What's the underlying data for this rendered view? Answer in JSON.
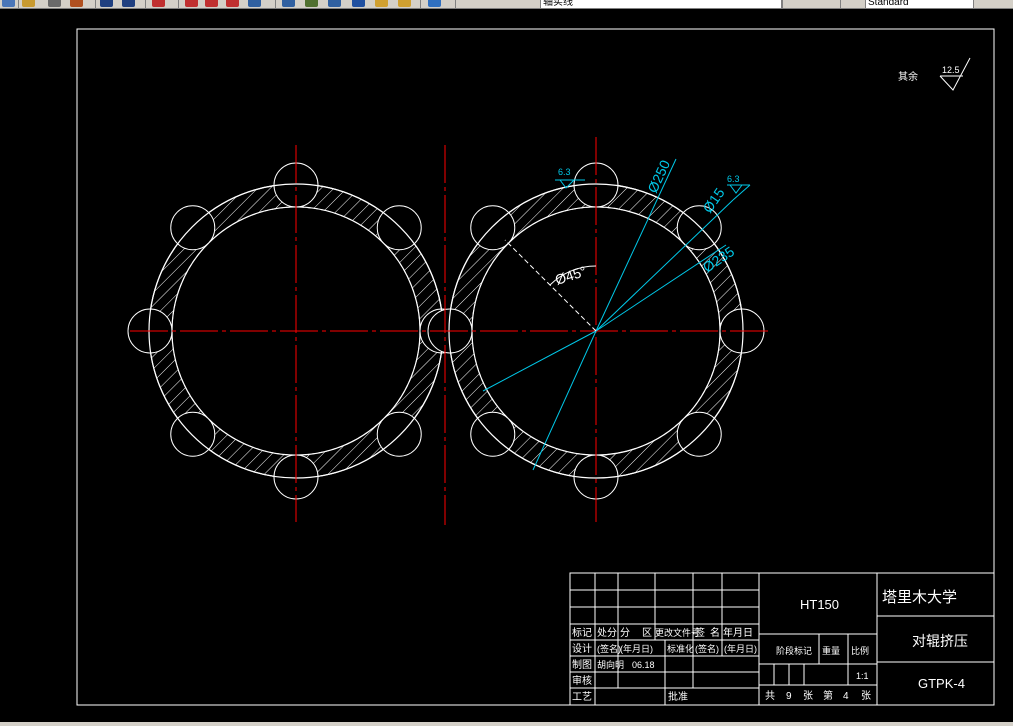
{
  "toolbar": {
    "layer_combo": "轴实线",
    "style_combo": "Standard",
    "icons": [
      "new-icon",
      "open-icon",
      "print-icon",
      "match-properties-icon",
      "undo-icon",
      "redo-icon",
      "zoom-realtime-icon",
      "zoom-window-icon",
      "zoom-previous-icon",
      "zoom-extents-icon",
      "properties-icon",
      "design-center-icon",
      "tool-palette-icon",
      "calculator-icon",
      "help-icon",
      "layer-manager-icon",
      "layer-state-icon",
      "text-style-icon"
    ]
  },
  "drawing": {
    "roughness_other_label": "其余",
    "roughness_other_value": "12.5",
    "dims": {
      "roughness_a": "6.3",
      "roughness_b": "6.3",
      "diam_outer": "Ø250",
      "diam_hole": "Ø15",
      "diam_pitch": "Ø235",
      "angle": "Ø45°"
    }
  },
  "title_block": {
    "material": "HT150",
    "school": "塔里木大学",
    "drawing_name": "对辊挤压",
    "drawing_no": "GTPK-4",
    "row_marks": [
      "标记",
      "处分",
      "分",
      "区",
      "更改文件号",
      "签",
      "名",
      "年月日"
    ],
    "row_design": [
      "设计",
      "(签名)",
      "(年月日)",
      "标准化",
      "(签名)",
      "(年月日)"
    ],
    "row_draw": [
      "制图",
      "胡向明",
      "06.18"
    ],
    "row_check": "审核",
    "row_process": [
      "工艺",
      "批准"
    ],
    "stage_label": "阶段标记",
    "weight_label": "重量",
    "scale_label": "比例",
    "scale_value": "1:1",
    "sheets": [
      "共",
      "9",
      "张",
      "第",
      "4",
      "张"
    ]
  },
  "colors": {
    "background": "#000000",
    "geometry": "#ffffff",
    "centerline": "#ff0000",
    "dimension": "#00c8e8"
  }
}
